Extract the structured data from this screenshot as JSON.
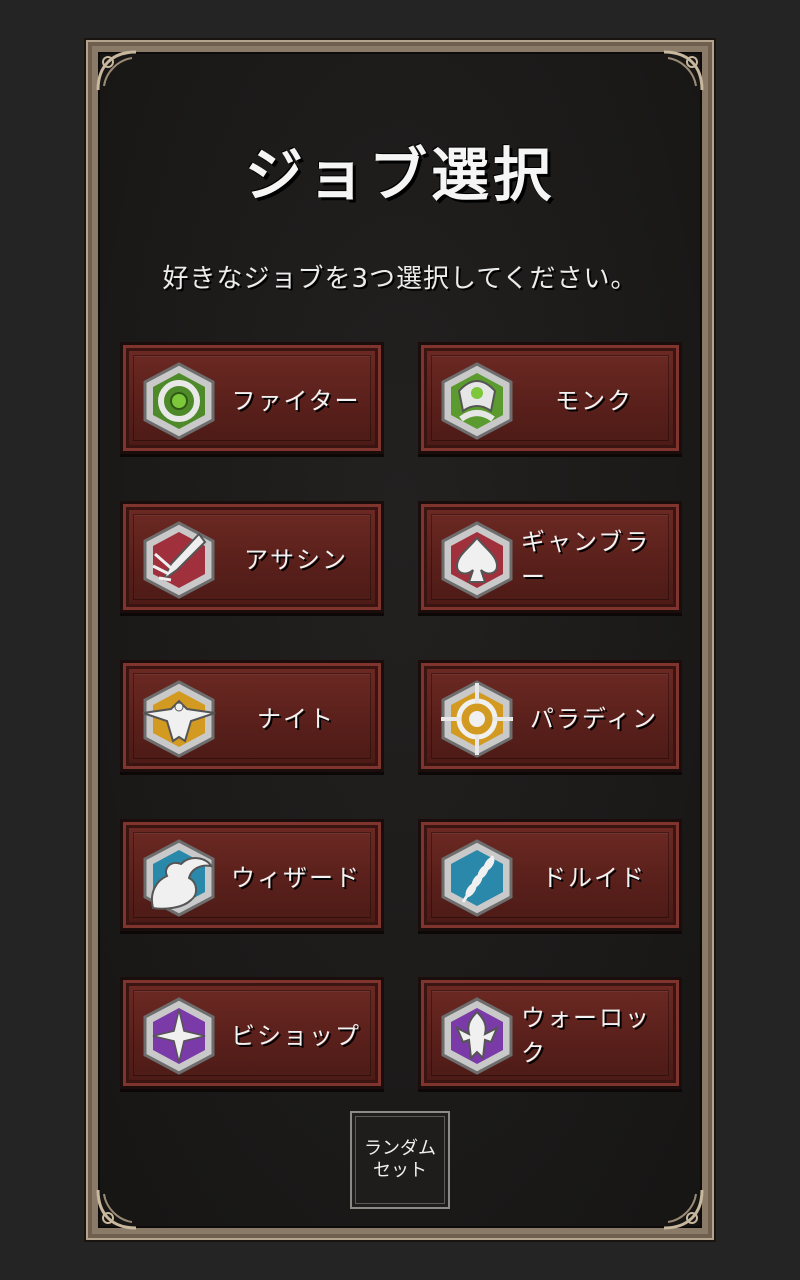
{
  "title": "ジョブ選択",
  "subtitle": "好きなジョブを3つ選択してください。",
  "jobs": [
    {
      "label": "ファイター",
      "icon": "fighter-icon",
      "color": "#4f8a2a"
    },
    {
      "label": "モンク",
      "icon": "monk-icon",
      "color": "#5a9a2e"
    },
    {
      "label": "アサシン",
      "icon": "assassin-icon",
      "color": "#a0303c"
    },
    {
      "label": "ギャンブラー",
      "icon": "gambler-icon",
      "color": "#a0303c"
    },
    {
      "label": "ナイト",
      "icon": "knight-icon",
      "color": "#d39a22"
    },
    {
      "label": "パラディン",
      "icon": "paladin-icon",
      "color": "#d39a22"
    },
    {
      "label": "ウィザード",
      "icon": "wizard-icon",
      "color": "#2a88aa"
    },
    {
      "label": "ドルイド",
      "icon": "druid-icon",
      "color": "#2a88aa"
    },
    {
      "label": "ビショップ",
      "icon": "bishop-icon",
      "color": "#7a3aa8"
    },
    {
      "label": "ウォーロック",
      "icon": "warlock-icon",
      "color": "#7a3aa8"
    }
  ],
  "random_button": {
    "line1": "ランダム",
    "line2": "セット"
  }
}
